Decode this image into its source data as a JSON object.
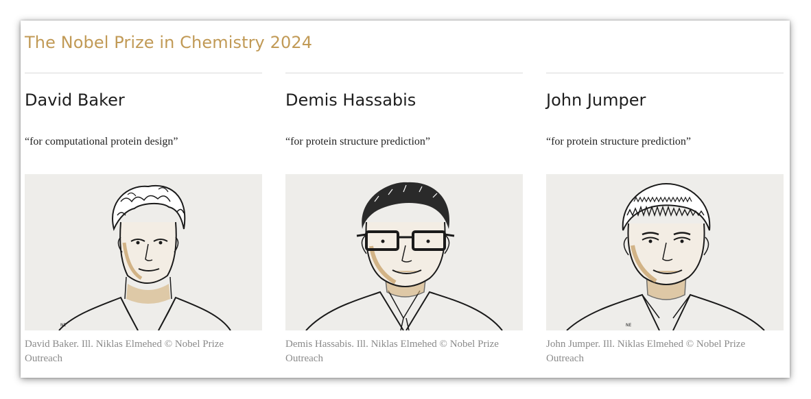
{
  "page": {
    "title": "The Nobel Prize in Chemistry 2024"
  },
  "laureates": [
    {
      "name": "David Baker",
      "motivation": "“for computational protein design”",
      "caption": "David Baker. Ill. Niklas Elmehed © Nobel Prize Outreach",
      "portrait_icon": "portrait-illustration"
    },
    {
      "name": "Demis Hassabis",
      "motivation": "“for protein structure prediction”",
      "caption": "Demis Hassabis. Ill. Niklas Elmehed © Nobel Prize Outreach",
      "portrait_icon": "portrait-illustration"
    },
    {
      "name": "John Jumper",
      "motivation": "“for protein structure prediction”",
      "caption": "John Jumper. Ill. Niklas Elmehed © Nobel Prize Outreach",
      "portrait_icon": "portrait-illustration"
    }
  ],
  "colors": {
    "title": "#c19a56",
    "portrait_bg": "#eeedea",
    "caption": "#8a8a8a",
    "ink": "#1a1a1a",
    "gold_shade": "#b8925a"
  }
}
